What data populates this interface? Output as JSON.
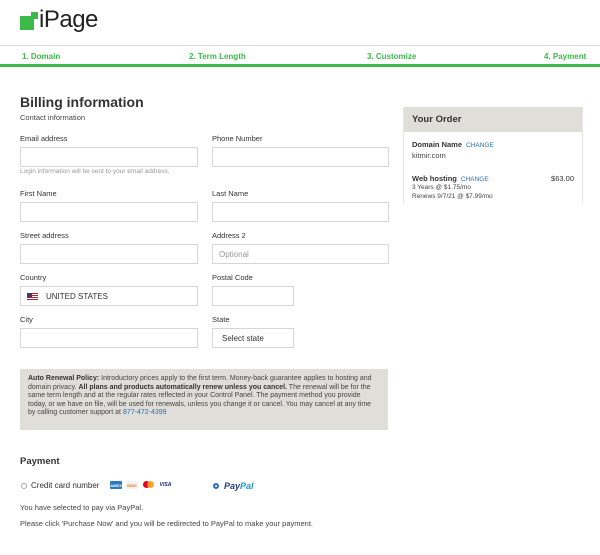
{
  "brand": {
    "name": "iPage",
    "color": "#3db94a"
  },
  "steps": [
    {
      "label": "1. Domain"
    },
    {
      "label": "2. Term Length"
    },
    {
      "label": "3. Customize"
    },
    {
      "label": "4. Payment"
    }
  ],
  "billing": {
    "title": "Billing information",
    "subtitle": "Contact information",
    "email": {
      "label": "Email address",
      "value": "",
      "hint": "Login information will be sent to your email address."
    },
    "phone": {
      "label": "Phone Number",
      "value": ""
    },
    "first_name": {
      "label": "First Name",
      "value": ""
    },
    "last_name": {
      "label": "Last Name",
      "value": ""
    },
    "street": {
      "label": "Street address",
      "value": ""
    },
    "address2": {
      "label": "Address 2",
      "placeholder": "Optional"
    },
    "country": {
      "label": "Country",
      "value": "UNITED STATES",
      "flag_icon": "us-flag-icon"
    },
    "postal": {
      "label": "Postal Code",
      "value": ""
    },
    "city": {
      "label": "City",
      "value": ""
    },
    "state": {
      "label": "State",
      "value": "Select state"
    }
  },
  "policy": {
    "heading": "Auto Renewal Policy:",
    "text1": " Introductory prices apply to the first term. Money-back guarantee applies to hosting and domain privacy. ",
    "bold": "All plans and products automatically renew unless you cancel.",
    "text2": " The renewal will be for the same term length and at the regular rates reflected in your Control Panel. The payment method you provide today, or we have on file, will be used for renewals, unless you change it or cancel. You may cancel at any time by calling customer support at ",
    "phone": "877-472-4399"
  },
  "payment": {
    "title": "Payment",
    "credit_card_label": "Credit card number",
    "card_icons": [
      "amex-icon",
      "discover-icon",
      "mastercard-icon",
      "visa-icon"
    ],
    "amex_text": "AMEX",
    "discover_text": "DISC",
    "visa_text": "VISA",
    "paypal_label_1": "Pay",
    "paypal_label_2": "Pal",
    "selected": "paypal",
    "note1": "You have selected to pay via PayPal.",
    "note2": "Please click 'Purchase Now' and you will be redirected to PayPal to make your payment."
  },
  "order": {
    "title": "Your Order",
    "domain_label": "Domain Name",
    "domain_change": "CHANGE",
    "domain_value": "kitmir.com",
    "hosting_label": "Web hosting",
    "hosting_change": "CHANGE",
    "hosting_price": "$63.00",
    "hosting_term": "3 Years @ $1.75/mo",
    "hosting_renew": "Renews 9/7/21 @ $7.99/mo"
  }
}
